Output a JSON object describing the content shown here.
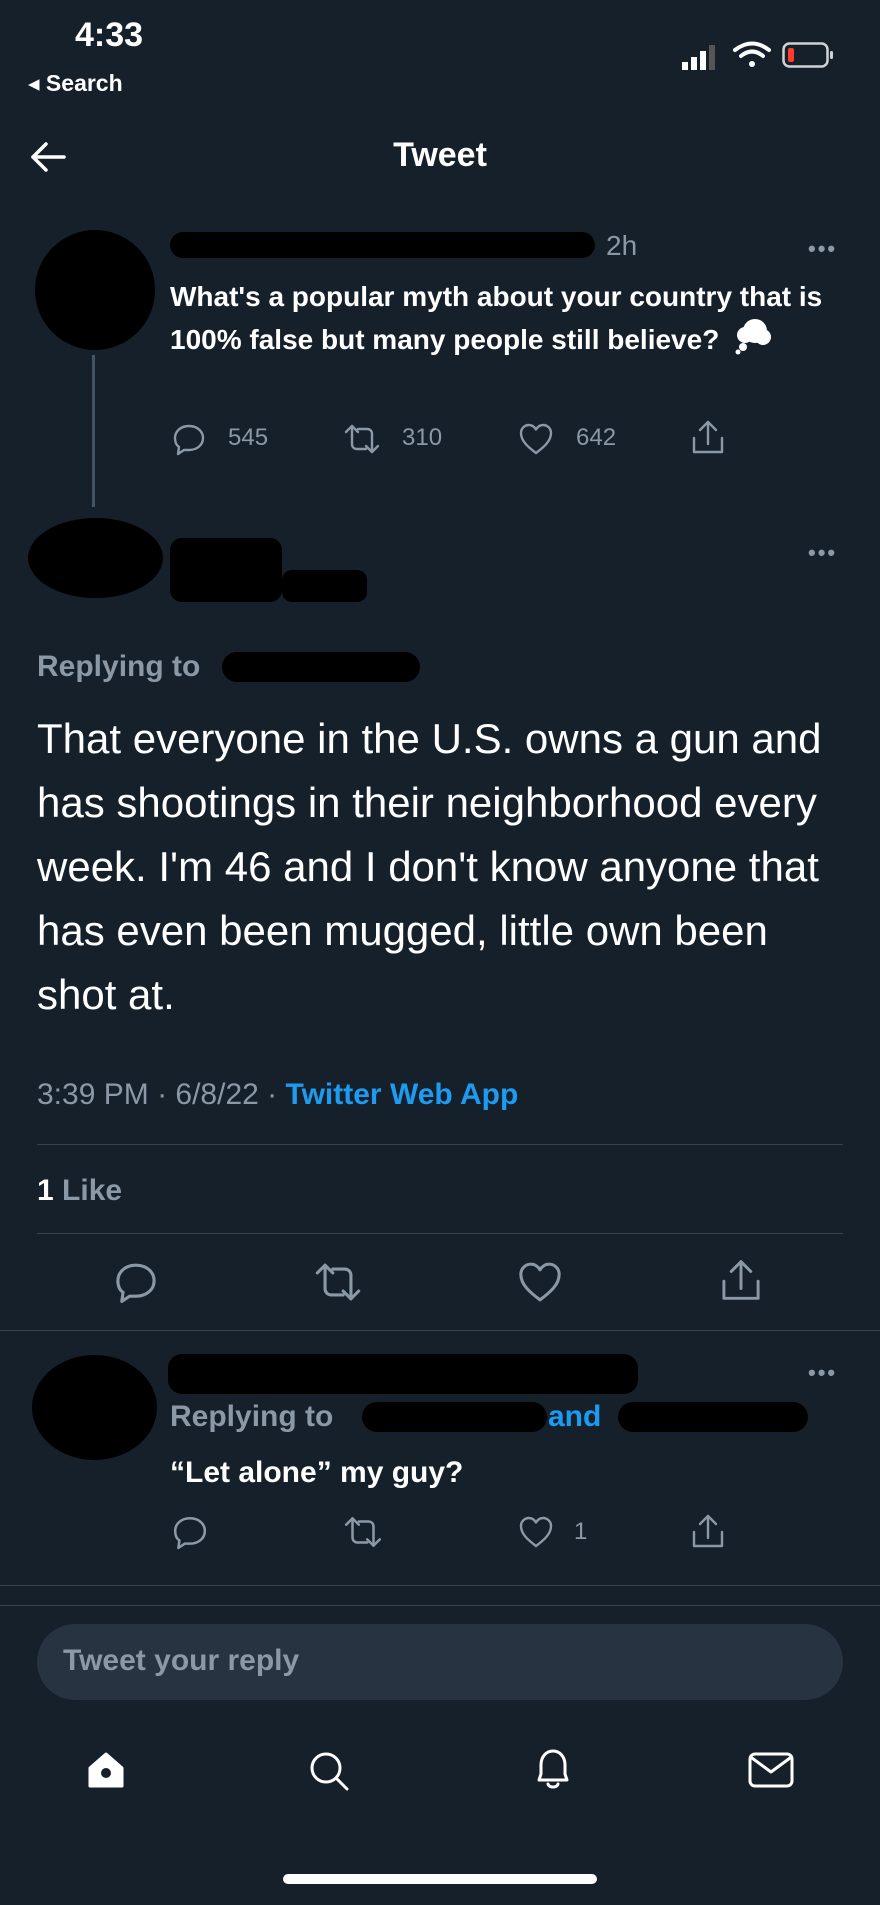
{
  "status_bar": {
    "time": "4:33",
    "back_label": "◂ Search"
  },
  "header": {
    "title": "Tweet"
  },
  "parent_tweet": {
    "time": "2h",
    "text": "What's a popular myth about your country that is 100% false but many people still believe?",
    "reply_count": "545",
    "retweet_count": "310",
    "like_count": "642"
  },
  "main_tweet": {
    "replying_to_label": "Replying to",
    "text": "That everyone in the U.S. owns a gun and has shootings in their neighborhood every week.  I'm 46 and I don't know anyone that has even been mugged, little own been shot at.",
    "time": "3:39 PM",
    "date": "6/8/22",
    "source": "Twitter Web App",
    "likes_number": "1",
    "likes_word": "Like"
  },
  "reply_tweet": {
    "replying_to_label": "Replying to",
    "and_label": "and",
    "text": "“Let alone” my guy?",
    "like_count": "1"
  },
  "composer": {
    "placeholder": "Tweet your reply"
  },
  "colors": {
    "background": "#15202b",
    "accent": "#1d9bf0",
    "muted": "#8b98a5"
  }
}
